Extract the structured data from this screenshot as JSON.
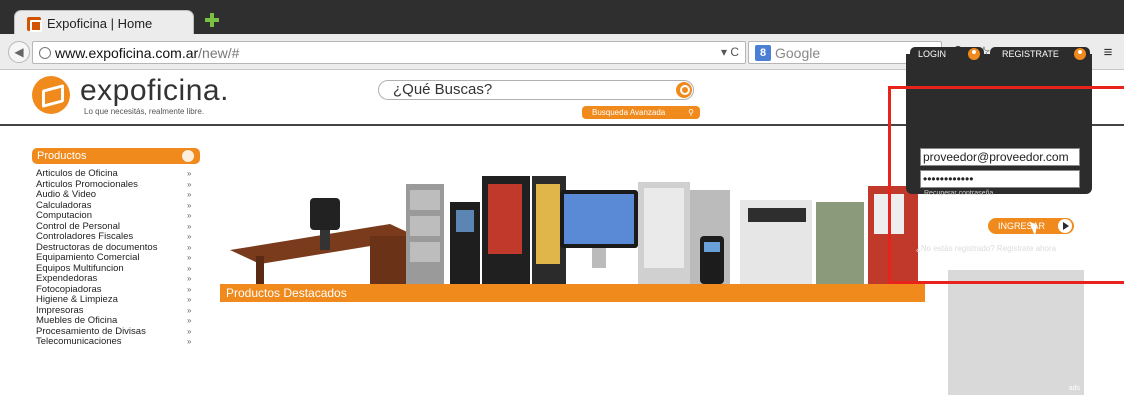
{
  "browser": {
    "tab_title": "Expoficina | Home",
    "url_domain": "www.expoficina.com.ar",
    "url_path": "/new/#",
    "search_engine": "Google"
  },
  "header": {
    "logo_text": "expoficina.",
    "tagline": "Lo que necesitás, realmente libre.",
    "search_placeholder": "¿Qué Buscas?",
    "advanced_search": "Busqueda Avanzada"
  },
  "sidebar": {
    "heading": "Productos",
    "items": [
      "Articulos de Oficina",
      "Articulos Promocionales",
      "Audio & Video",
      "Calculadoras",
      "Computacion",
      "Control de Personal",
      "Controladores Fiscales",
      "Destructoras de documentos",
      "Equipamiento Comercial",
      "Equipos Multifuncion",
      "Expendedoras",
      "Fotocopiadoras",
      "Higiene & Limpieza",
      "Impresoras",
      "Muebles de Oficina",
      "Procesamiento de Divisas",
      "Telecomunicaciones"
    ]
  },
  "main": {
    "featured_label": "Productos Destacados",
    "ad_label": "ads"
  },
  "login": {
    "tab_login": "LOGIN",
    "tab_register": "REGISTRATE",
    "email_value": "proveedor@proveedor.com",
    "password_mask": "••••••••••••",
    "recover": "Recuperar contraseña",
    "submit": "INGRESAR",
    "not_registered": "¿No estás registrado? Registrate ahora"
  },
  "colors": {
    "accent": "#f08a1c",
    "annotation": "#e8231b",
    "panel": "#2c2c2c"
  }
}
